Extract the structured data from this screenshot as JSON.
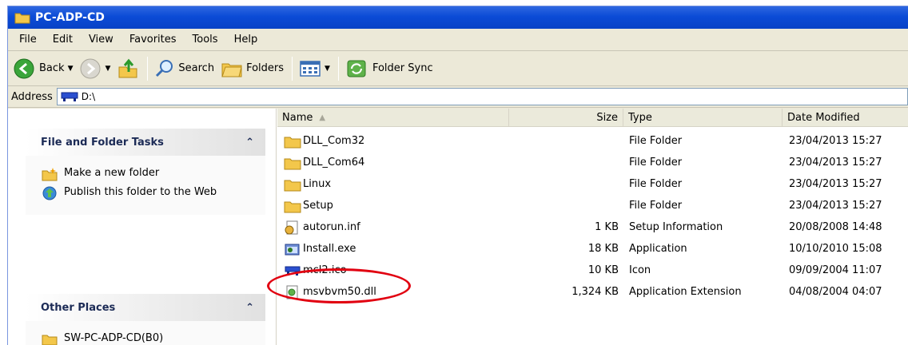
{
  "window": {
    "title": "PC-ADP-CD"
  },
  "menu": [
    "File",
    "Edit",
    "View",
    "Favorites",
    "Tools",
    "Help"
  ],
  "toolbar": {
    "back": "Back",
    "search": "Search",
    "folders": "Folders",
    "folder_sync": "Folder Sync"
  },
  "address": {
    "label": "Address",
    "value": "D:\\"
  },
  "tasks": {
    "file_folder_title": "File and Folder Tasks",
    "make_folder": "Make a new folder",
    "publish": "Publish this folder to the Web",
    "other_places_title": "Other Places",
    "other_place_1": "SW-PC-ADP-CD(B0)"
  },
  "columns": {
    "name": "Name",
    "size": "Size",
    "type": "Type",
    "date": "Date Modified"
  },
  "files": [
    {
      "name": "DLL_Com32",
      "size": "",
      "type": "File Folder",
      "date": "23/04/2013 15:27",
      "icon": "folder-icon"
    },
    {
      "name": "DLL_Com64",
      "size": "",
      "type": "File Folder",
      "date": "23/04/2013 15:27",
      "icon": "folder-icon"
    },
    {
      "name": "Linux",
      "size": "",
      "type": "File Folder",
      "date": "23/04/2013 15:27",
      "icon": "folder-icon"
    },
    {
      "name": "Setup",
      "size": "",
      "type": "File Folder",
      "date": "23/04/2013 15:27",
      "icon": "folder-icon"
    },
    {
      "name": "autorun.inf",
      "size": "1 KB",
      "type": "Setup Information",
      "date": "20/08/2008 14:48",
      "icon": "setup-info-icon"
    },
    {
      "name": "Install.exe",
      "size": "18 KB",
      "type": "Application",
      "date": "10/10/2010 15:08",
      "icon": "application-icon"
    },
    {
      "name": "mcl2.ico",
      "size": "10 KB",
      "type": "Icon",
      "date": "09/09/2004 11:07",
      "icon": "ico-file-icon"
    },
    {
      "name": "msvbvm50.dll",
      "size": "1,324 KB",
      "type": "Application Extension",
      "date": "04/08/2004 04:07",
      "icon": "dll-file-icon"
    }
  ],
  "colors": {
    "titlebar": "#0b4bd6",
    "callout": "#e10010",
    "panel_title": "#1c2b56"
  }
}
